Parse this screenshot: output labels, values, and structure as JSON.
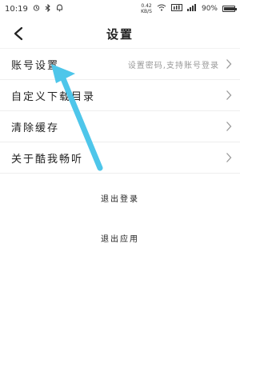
{
  "status_bar": {
    "time": "10:19",
    "icons": [
      "alarm-icon",
      "bluetooth-icon",
      "notification-icon"
    ],
    "net_speed_value": "0.42",
    "net_speed_unit": "KB/S",
    "battery_label": "90%"
  },
  "header": {
    "title": "设置",
    "back_icon": "chevron-left-icon"
  },
  "settings": {
    "items": [
      {
        "label": "账号设置",
        "value": "设置密码,支持账号登录"
      },
      {
        "label": "自定义下载目录",
        "value": ""
      },
      {
        "label": "清除缓存",
        "value": ""
      },
      {
        "label": "关于酷我畅听",
        "value": ""
      }
    ]
  },
  "actions": {
    "logout": "退出登录",
    "exit_app": "退出应用"
  },
  "annotation": {
    "arrow_color": "#4EC6EA",
    "arrow_icon": "arrow-icon"
  }
}
